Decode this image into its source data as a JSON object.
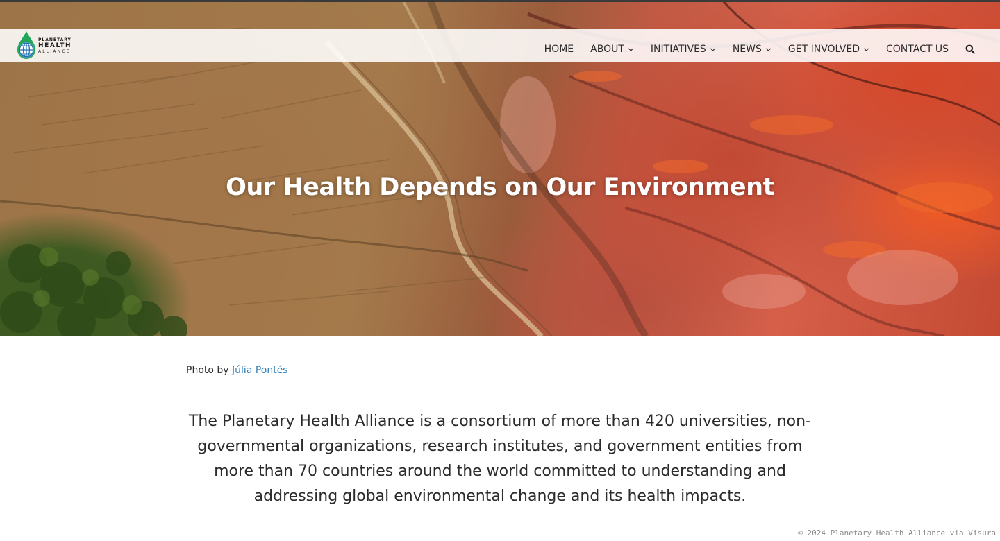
{
  "header": {
    "logo": {
      "line1": "PLANETARY",
      "line2": "HEALTH",
      "line3": "ALLIANCE"
    },
    "nav": [
      {
        "label": "HOME",
        "dropdown": false,
        "active": true
      },
      {
        "label": "ABOUT",
        "dropdown": true,
        "active": false
      },
      {
        "label": "INITIATIVES",
        "dropdown": true,
        "active": false
      },
      {
        "label": "NEWS",
        "dropdown": true,
        "active": false
      },
      {
        "label": "GET INVOLVED",
        "dropdown": true,
        "active": false
      },
      {
        "label": "CONTACT US",
        "dropdown": false,
        "active": false
      }
    ],
    "search_icon": "search-icon"
  },
  "hero": {
    "title": "Our Health Depends on Our Environment"
  },
  "credit": {
    "prefix": "Photo by",
    "photographer": "Júlia Pontés"
  },
  "intro": {
    "text": "The Planetary Health Alliance is a consortium of more than 420 universities, non-governmental organizations, research institutes, and government entities from more than 70 countries around the world committed to understanding and addressing global environmental change and its health impacts."
  },
  "footer": {
    "copyright": "© 2024 Planetary Health Alliance via Visura"
  },
  "colors": {
    "link": "#2f7fb8",
    "text": "#2b2b2b",
    "header_bg": "#ffffff"
  }
}
